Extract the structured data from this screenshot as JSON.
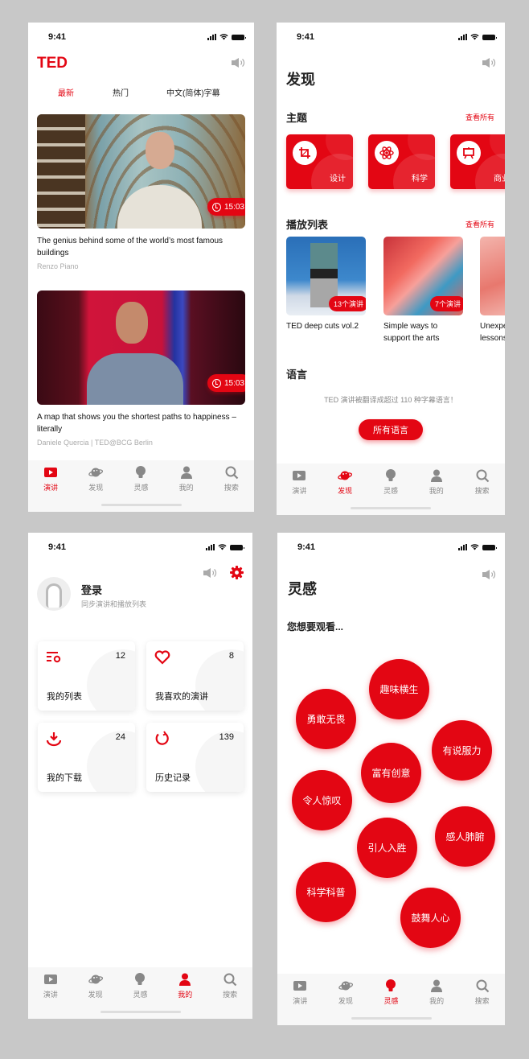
{
  "status_time": "9:41",
  "tabbar": [
    {
      "label": "演讲",
      "icon": "play-icon"
    },
    {
      "label": "发现",
      "icon": "planet-icon"
    },
    {
      "label": "灵感",
      "icon": "lightbulb-icon"
    },
    {
      "label": "我的",
      "icon": "user-icon"
    },
    {
      "label": "搜索",
      "icon": "search-icon"
    }
  ],
  "talks_screen": {
    "logo": "TED",
    "tabs": [
      "最新",
      "热门",
      "中文(简体)字幕"
    ],
    "active_tab": "最新",
    "talks": [
      {
        "title": "The genius behind some of the world’s most famous buildings",
        "speaker": "Renzo Piano",
        "duration": "15:03"
      },
      {
        "title": "A map that shows you the shortest paths to happiness – literally",
        "speaker": "Daniele Quercia | TED@BCG Berlin",
        "duration": "15:03"
      }
    ],
    "active_nav": "演讲"
  },
  "discover_screen": {
    "title": "发现",
    "topics_title": "主题",
    "see_all": "查看所有",
    "topics": [
      {
        "label": "设计",
        "icon": "crop-icon"
      },
      {
        "label": "科学",
        "icon": "atom-icon"
      },
      {
        "label": "商业",
        "icon": "presentation-icon"
      }
    ],
    "playlists_title": "播放列表",
    "playlists": [
      {
        "name": "TED deep cuts vol.2",
        "count": "13个演讲"
      },
      {
        "name": "Simple ways to support the arts",
        "count": "7个演讲"
      },
      {
        "name": "Unexpected lessons from the...",
        "count": ""
      }
    ],
    "language_title": "语言",
    "language_desc": "TED 演讲被翻译成超过 110 种字幕语言！",
    "language_button": "所有语言",
    "active_nav": "发现"
  },
  "profile_screen": {
    "login_label": "登录",
    "login_sub": "同步演讲和播放列表",
    "cards": [
      {
        "label": "我的列表",
        "count": "12",
        "icon": "list-icon"
      },
      {
        "label": "我喜欢的演讲",
        "count": "8",
        "icon": "heart-icon"
      },
      {
        "label": "我的下载",
        "count": "24",
        "icon": "download-icon"
      },
      {
        "label": "历史记录",
        "count": "139",
        "icon": "history-icon"
      }
    ],
    "active_nav": "我的"
  },
  "inspire_screen": {
    "title": "灵感",
    "prompt": "您想要观看...",
    "moods": [
      "趣味横生",
      "勇敢无畏",
      "有说服力",
      "富有创意",
      "令人惊叹",
      "感人肺腑",
      "引人入胜",
      "科学科普",
      "鼓舞人心"
    ],
    "active_nav": "灵感"
  },
  "colors": {
    "brand": "#e30613",
    "background": "#c8c8c8",
    "inactive": "#888888"
  }
}
